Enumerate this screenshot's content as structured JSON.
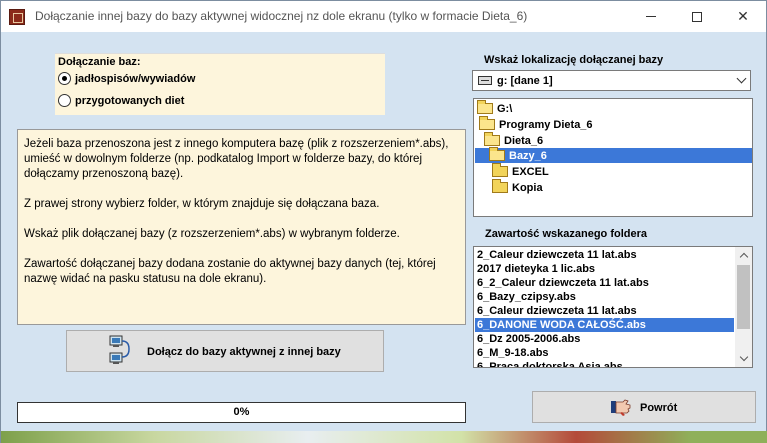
{
  "window": {
    "title": "Dołączanie innej bazy do bazy aktywnej widocznej nz dole ekranu (tylko w formacie Dieta_6)"
  },
  "join_group": {
    "label": "Dołączanie baz:",
    "options": [
      {
        "label": "jadłospisów/wywiadów",
        "checked": true
      },
      {
        "label": "przygotowanych diet",
        "checked": false
      }
    ]
  },
  "info": {
    "paragraphs": [
      "Jeżeli baza przenoszona jest z innego komputera bazę (plik z rozszerzeniem*.abs), umieść w dowolnym folderze (np. podkatalog Import w folderze bazy, do której dołączamy przenoszoną bazę).",
      "Z prawej strony wybierz folder, w którym znajduje się dołączana baza.",
      "Wskaż plik dołączanej bazy (z rozszerzeniem*.abs) w wybranym folderze.",
      "Zawartość dołączanej bazy dodana zostanie do aktywnej bazy danych (tej, której nazwę widać na pasku statusu na dole ekranu)."
    ]
  },
  "join_button": {
    "label": "Dołącz do bazy aktywnej z innej bazy"
  },
  "progress": {
    "value": 0,
    "label": "0%"
  },
  "location": {
    "label": "Wskaż lokalizację dołączanej bazy",
    "drive": "g: [dane 1]",
    "folders": [
      {
        "label": "G:\\",
        "open": true,
        "selected": false
      },
      {
        "label": "Programy Dieta_6",
        "open": true,
        "selected": false
      },
      {
        "label": "Dieta_6",
        "open": true,
        "selected": false
      },
      {
        "label": "Bazy_6",
        "open": true,
        "selected": true
      },
      {
        "label": "EXCEL",
        "open": false,
        "selected": false
      },
      {
        "label": "Kopia",
        "open": false,
        "selected": false
      }
    ]
  },
  "contents": {
    "label": "Zawartość wskazanego foldera",
    "files": [
      {
        "label": "2_Caleur dziewczeta 11 lat.abs",
        "selected": false
      },
      {
        "label": "2017 dieteyka 1 lic.abs",
        "selected": false
      },
      {
        "label": "6_2_Caleur dziewczeta 11 lat.abs",
        "selected": false
      },
      {
        "label": "6_Bazy_czipsy.abs",
        "selected": false
      },
      {
        "label": "6_Caleur dziewczeta 11 lat.abs",
        "selected": false
      },
      {
        "label": "6_DANONE WODA CAŁOŚĆ.abs",
        "selected": true
      },
      {
        "label": "6_Dz 2005-2006.abs",
        "selected": false
      },
      {
        "label": "6_M_9-18.abs",
        "selected": false
      },
      {
        "label": "6_Praca doktorska Asia.abs",
        "selected": false
      }
    ]
  },
  "back_button": {
    "label": "Powrót"
  }
}
